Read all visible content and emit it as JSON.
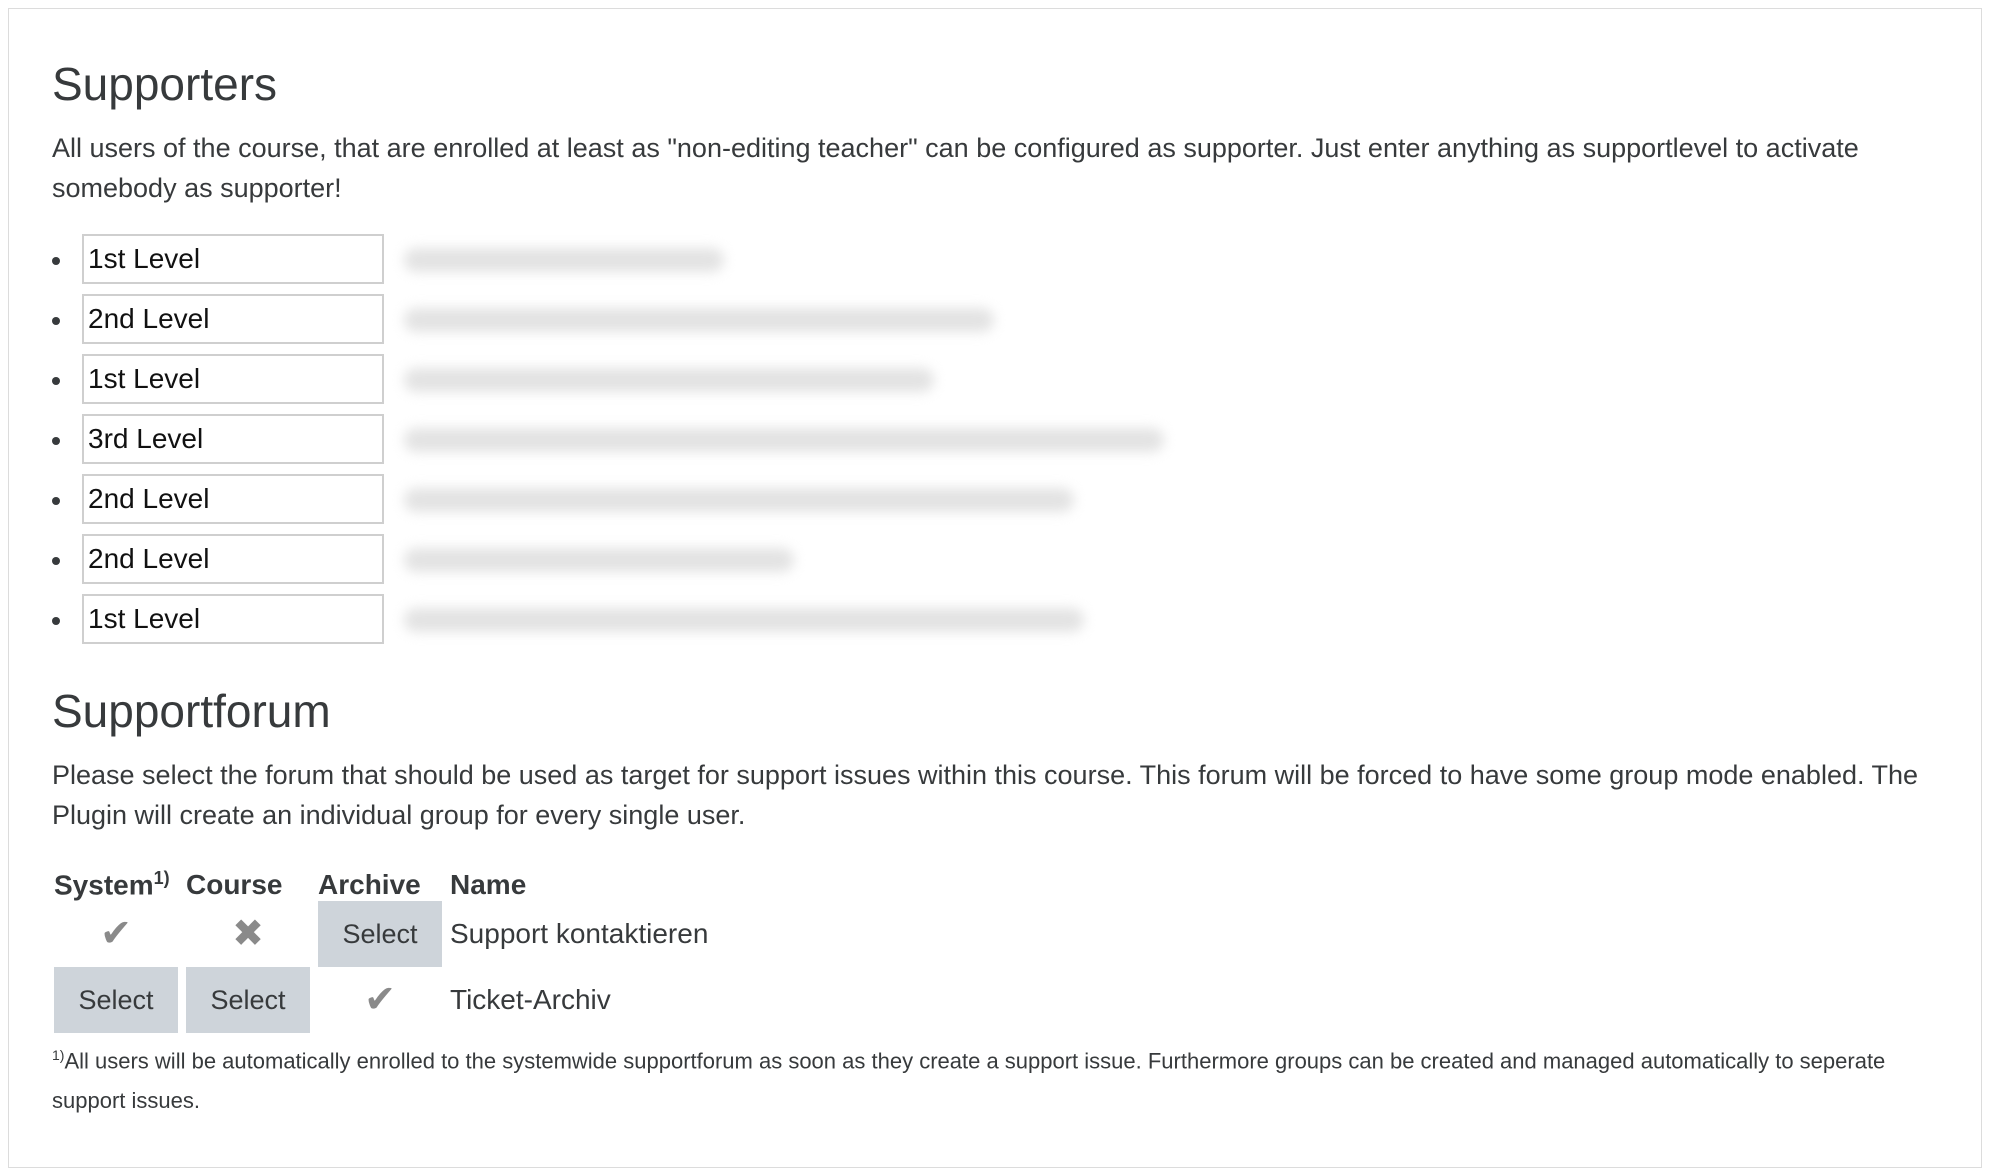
{
  "supporters": {
    "title": "Supporters",
    "description": "All users of the course, that are enrolled at least as \"non-editing teacher\" can be configured as supporter. Just enter anything as supportlevel to activate somebody as supporter!",
    "levels": [
      {
        "value": "1st Level"
      },
      {
        "value": "2nd Level"
      },
      {
        "value": "1st Level"
      },
      {
        "value": "3rd Level"
      },
      {
        "value": "2nd Level"
      },
      {
        "value": "2nd Level"
      },
      {
        "value": "1st Level"
      }
    ]
  },
  "supportforum": {
    "title": "Supportforum",
    "description": "Please select the forum that should be used as target for support issues within this course. This forum will be forced to have some group mode enabled. The Plugin will create an individual group for every single user.",
    "table": {
      "headers": {
        "system": "System",
        "system_sup": "1)",
        "course": "Course",
        "archive": "Archive",
        "name": "Name"
      },
      "rows": [
        {
          "system": "check-icon",
          "course": "cross-icon",
          "archive": "Select",
          "name": "Support kontaktieren"
        },
        {
          "system": "Select",
          "course": "Select",
          "archive": "check-icon",
          "name": "Ticket-Archiv"
        }
      ],
      "select_label": "Select"
    },
    "footnote_marker": "1)",
    "footnote": "All users will be automatically enrolled to the systemwide supportforum as soon as they create a support issue. Furthermore groups can be created and managed automatically to seperate support issues."
  },
  "icons": {
    "check": "✔",
    "cross": "✖"
  },
  "colors": {
    "button_bg": "#ced4da",
    "icon": "#8a8a8a",
    "text": "#373a3c"
  }
}
